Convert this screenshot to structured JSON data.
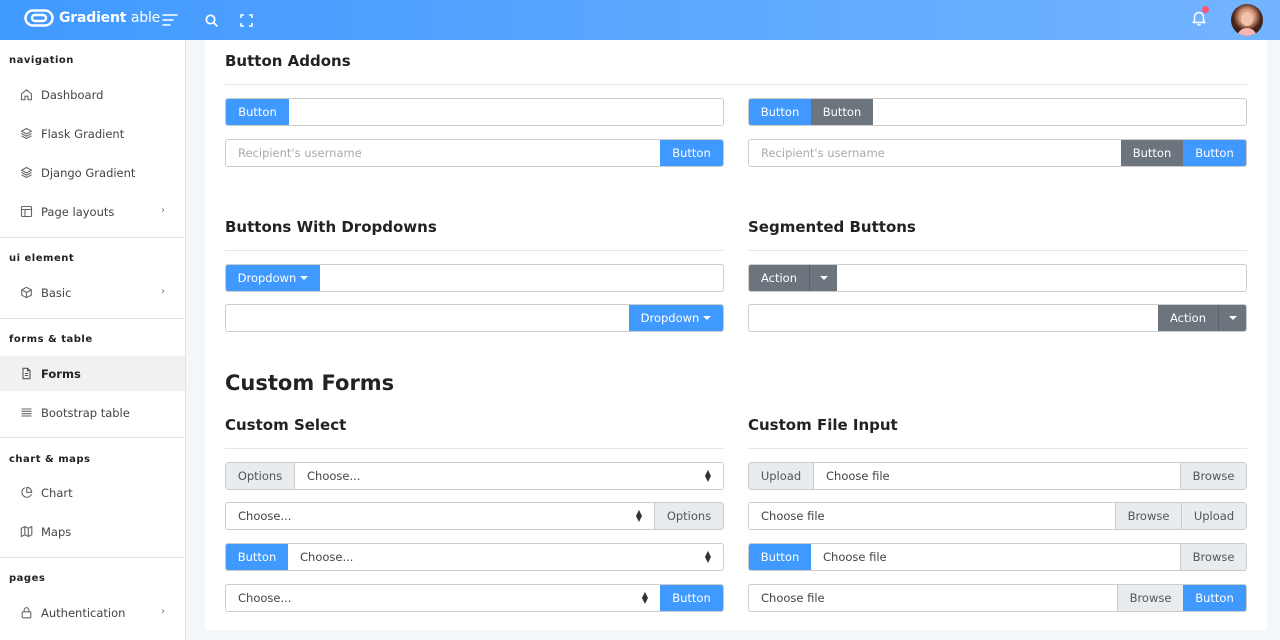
{
  "brand": {
    "name_bold": "Gradient",
    "name_light": "able"
  },
  "header": {
    "menu_icon": "hamburger-icon",
    "search_icon": "search-icon",
    "fullscreen_icon": "fullscreen-icon",
    "bell_icon": "bell-icon",
    "badge_color": "#ff5370"
  },
  "sidebar": {
    "sections": [
      {
        "label": "navigation",
        "items": [
          {
            "label": "Dashboard",
            "icon": "home-icon"
          },
          {
            "label": "Flask Gradient",
            "icon": "layers-icon"
          },
          {
            "label": "Django Gradient",
            "icon": "layers-icon"
          },
          {
            "label": "Page layouts",
            "icon": "layout-icon",
            "chevron": "›"
          }
        ]
      },
      {
        "label": "ui element",
        "items": [
          {
            "label": "Basic",
            "icon": "box-icon",
            "chevron": "›"
          }
        ]
      },
      {
        "label": "forms & table",
        "items": [
          {
            "label": "Forms",
            "icon": "file-text-icon",
            "active": true
          },
          {
            "label": "Bootstrap table",
            "icon": "align-justify-icon"
          }
        ]
      },
      {
        "label": "chart & maps",
        "items": [
          {
            "label": "Chart",
            "icon": "pie-chart-icon"
          },
          {
            "label": "Maps",
            "icon": "map-icon"
          }
        ]
      },
      {
        "label": "pages",
        "items": [
          {
            "label": "Authentication",
            "icon": "lock-icon",
            "chevron": "›"
          }
        ]
      }
    ]
  },
  "content": {
    "button_addons": {
      "title": "Button Addons",
      "btn": "Button",
      "placeholder": "Recipient's username"
    },
    "dropdowns": {
      "title": "Buttons With Dropdowns",
      "btn": "Dropdown"
    },
    "segmented": {
      "title": "Segmented Buttons",
      "btn": "Action"
    },
    "custom_forms": {
      "title": "Custom Forms"
    },
    "custom_select": {
      "title": "Custom Select",
      "addon": "Options",
      "choose": "Choose...",
      "btn": "Button"
    },
    "custom_file": {
      "title": "Custom File Input",
      "upload": "Upload",
      "choose": "Choose file",
      "browse": "Browse",
      "btn": "Button"
    }
  },
  "colors": {
    "primary": "#4099ff",
    "secondary": "#6c757d",
    "addon_bg": "#e9ecef"
  }
}
